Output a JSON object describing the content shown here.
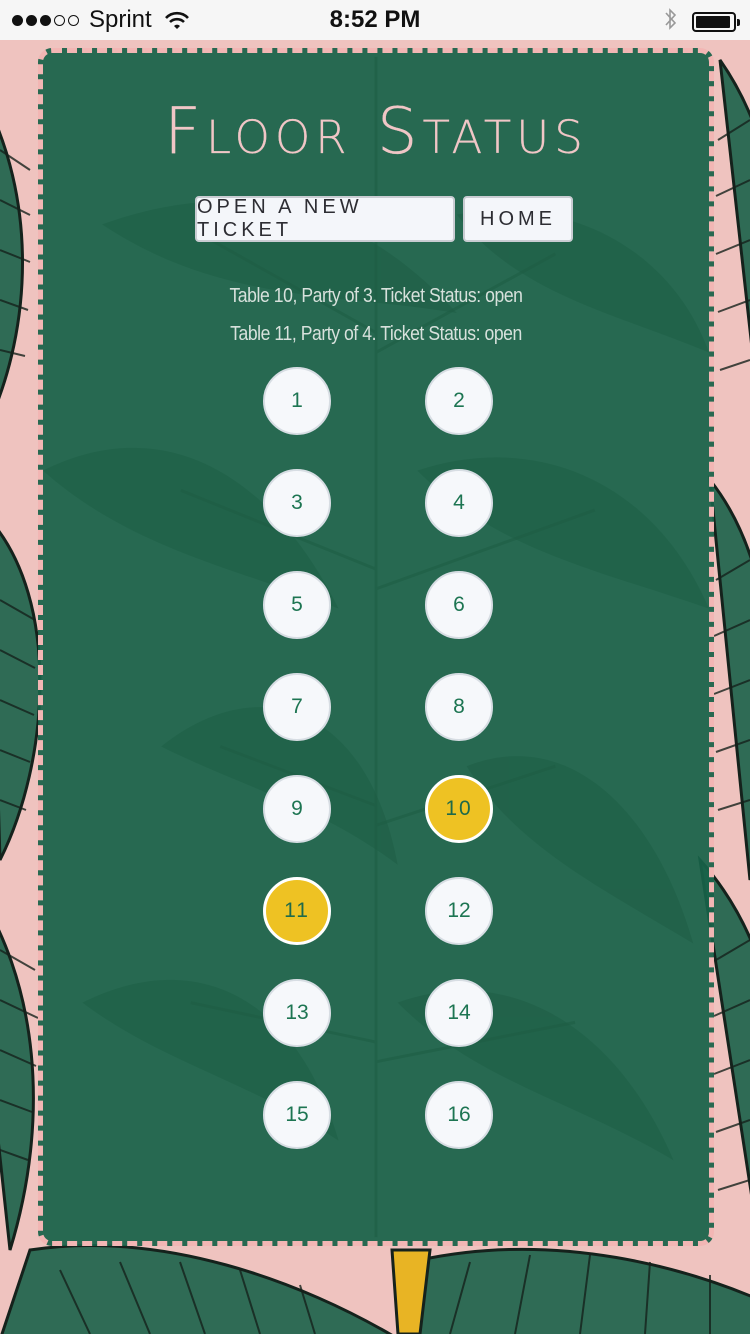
{
  "status_bar": {
    "carrier": "Sprint",
    "time": "8:52 PM",
    "signal_bars_filled": 3,
    "signal_bars_total": 5,
    "battery_level": 0.95,
    "icons": [
      "signal-dots-icon",
      "wifi-icon",
      "bluetooth-icon",
      "battery-icon"
    ]
  },
  "page": {
    "title": "Floor Status",
    "buttons": {
      "open_ticket": "OPEN A NEW TICKET",
      "home": "HOME"
    },
    "messages": [
      "Table 10, Party of 3. Ticket Status: open",
      "Table 11, Party of 4. Ticket Status: open"
    ],
    "tables": [
      {
        "label": "1",
        "occupied": false
      },
      {
        "label": "2",
        "occupied": false
      },
      {
        "label": "3",
        "occupied": false
      },
      {
        "label": "4",
        "occupied": false
      },
      {
        "label": "5",
        "occupied": false
      },
      {
        "label": "6",
        "occupied": false
      },
      {
        "label": "7",
        "occupied": false
      },
      {
        "label": "8",
        "occupied": false
      },
      {
        "label": "9",
        "occupied": false
      },
      {
        "label": "10",
        "occupied": true
      },
      {
        "label": "11",
        "occupied": true
      },
      {
        "label": "12",
        "occupied": false
      },
      {
        "label": "13",
        "occupied": false
      },
      {
        "label": "14",
        "occupied": false
      },
      {
        "label": "15",
        "occupied": false
      },
      {
        "label": "16",
        "occupied": false
      }
    ]
  },
  "colors": {
    "background_pink": "#efc3bf",
    "panel_green": "#186248",
    "border_pink": "#f2b6b4",
    "title_pink": "#f0c6c6",
    "table_white": "#f6f8fb",
    "table_occupied_yellow": "#eec223",
    "table_text_green": "#1d7552"
  }
}
